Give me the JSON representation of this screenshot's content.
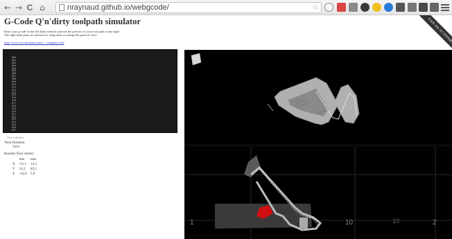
{
  "browser": {
    "url": "nraynaud.github.io/webgcode/",
    "nav": {
      "back": "←",
      "forward": "→",
      "reload": "C",
      "home": "⌂"
    }
  },
  "ribbon": {
    "text": "Fork me on GitHub"
  },
  "page": {
    "title": "G-Code Q'n'dirty toolpath simulator",
    "description_line1": "Paste your g-code in the left hand window and see the preview of your tool path on the right",
    "description_line2": "The right hand pane are interactive: drag them to change the point of view.",
    "link": "http://www.cnc-simulator.com/ ... example code"
  },
  "code": {
    "line_numbers": [
      "000",
      "001",
      "002",
      "003",
      "004",
      "005",
      "006",
      "007",
      "008",
      "009",
      "010",
      "011",
      "012",
      "013",
      "014",
      "015",
      "016",
      "017",
      "018",
      "019",
      "020",
      "021",
      "022",
      "023",
      "024",
      "025",
      "026",
      "027"
    ],
    "footer": "Your code here"
  },
  "stats": {
    "duration_label": "Total Duration:",
    "duration_value": "?m?s",
    "bounds_label": "Bounds (Tool center)",
    "bounds_header": [
      "min",
      "max"
    ],
    "bounds_rows": [
      {
        "axis": "X",
        "min": "-51.1",
        "max": "14.3"
      },
      {
        "axis": "Y",
        "min": "16.2",
        "max": "83.2"
      },
      {
        "axis": "Z",
        "min": "-10.0",
        "max": "5.0"
      }
    ]
  },
  "viewport_bottom": {
    "axis_ticks": [
      "1",
      "10",
      "10",
      "2"
    ]
  }
}
